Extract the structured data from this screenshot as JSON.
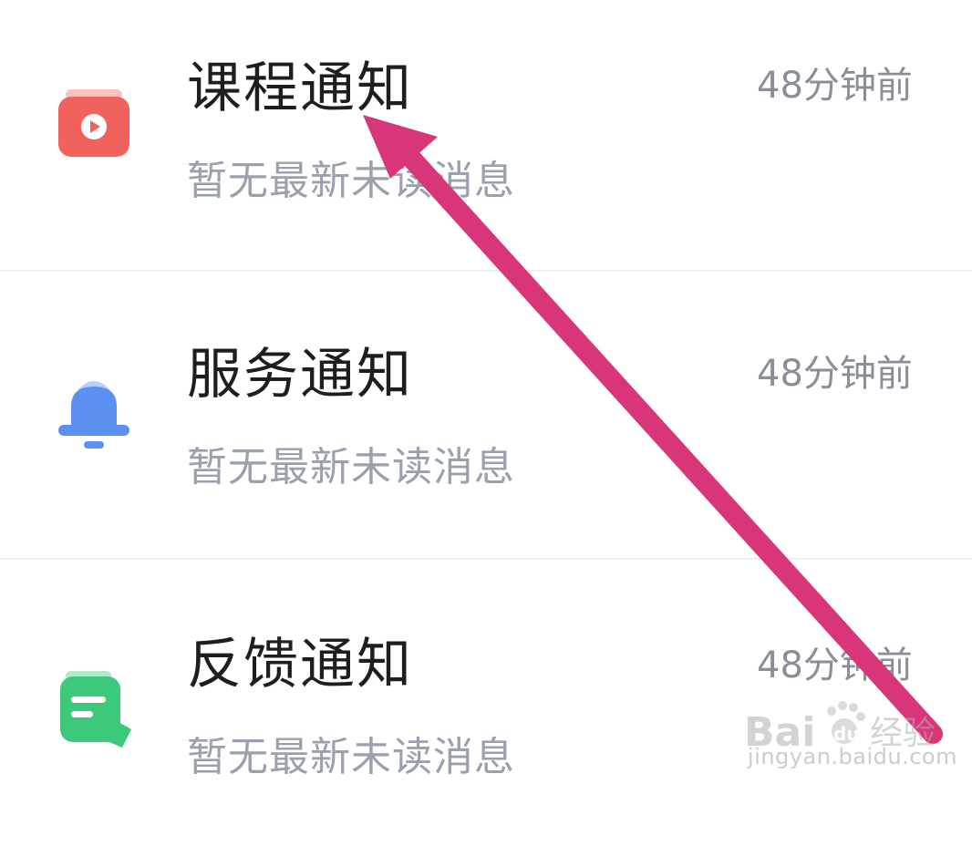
{
  "notifications": [
    {
      "title": "课程通知",
      "time": "48分钟前",
      "subtitle": "暂无最新未读消息",
      "icon": "video-play-icon",
      "color": "#f1625d"
    },
    {
      "title": "服务通知",
      "time": "48分钟前",
      "subtitle": "暂无最新未读消息",
      "icon": "bell-icon",
      "color": "#5b8ff2"
    },
    {
      "title": "反馈通知",
      "time": "48分钟前",
      "subtitle": "暂无最新未读消息",
      "icon": "note-edit-icon",
      "color": "#3cc97a"
    }
  ],
  "annotation": {
    "arrow_color": "#d9367a"
  },
  "watermark": {
    "brand": "Baidu经验",
    "url": "jingyan.baidu.com"
  }
}
